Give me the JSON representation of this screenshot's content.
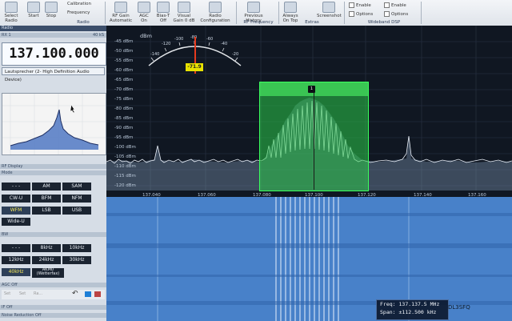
{
  "ribbon": {
    "buttons": [
      "Select Radio",
      "Start",
      "Stop",
      "Calibration",
      "Frequency",
      "RF Gain Automatic",
      "AGC On",
      "Bias-T Off",
      "Visual Gain 0 dB",
      "Radio Configuration",
      "Previous History",
      "Next History",
      "Always On Top",
      "Screenshot"
    ],
    "groups": [
      "Radio",
      "RF Frequency",
      "Extras",
      "Wideband DSP"
    ],
    "checks": [
      "Enable",
      "Options",
      "Enable",
      "Options"
    ]
  },
  "left": {
    "panel_title": "Radio",
    "rx_label": "RX 1",
    "rx_level": "40 kS",
    "frequency": "137.100.000",
    "audio_device": "Lautsprecher (2- High Definition Audio Device)",
    "rf_display_title": "RF Display",
    "mode_title": "Mode",
    "modes": [
      "- - -",
      "AM",
      "SAM",
      "CW-U",
      "BFM",
      "NFM",
      "WFM",
      "LSB",
      "USB",
      "Wide-U"
    ],
    "selected_mode": "WFM",
    "bw_title": "BW",
    "bandwidths": [
      "- - -",
      "8kHz",
      "10kHz",
      "12kHz",
      "24kHz",
      "30kHz",
      "40kHz",
      "AKM0 (Wetterfax)"
    ],
    "selected_bw": "40kHz",
    "agc_title": "AGC Off",
    "ctrl_title": "IF Off",
    "ctrl_title2": "Noise Reduction Off",
    "buttons_small": [
      "Set",
      "Set",
      "Ra..."
    ]
  },
  "spectrum": {
    "unit": "dBm",
    "db_ticks": [
      "-45 dBm",
      "-50 dBm",
      "-55 dBm",
      "-60 dBm",
      "-65 dBm",
      "-70 dBm",
      "-75 dBm",
      "-80 dBm",
      "-85 dBm",
      "-90 dBm",
      "-95 dBm",
      "-100 dBm",
      "-105 dBm",
      "-110 dBm",
      "-115 dBm",
      "-120 dBm"
    ],
    "freq_ticks": [
      "137.040",
      "137.060",
      "137.080",
      "137.100",
      "137.120",
      "137.140",
      "137.160"
    ],
    "meter_ticks": [
      "-140",
      "-120",
      "-100",
      "-80",
      "-60",
      "-40",
      "-20"
    ],
    "meter_value": "-71.9",
    "channel_marker": "1"
  },
  "info": {
    "freq_label": "Freq:",
    "freq_value": "137.137.5 MHz",
    "span_label": "Span:",
    "span_value": "±112.500 kHz"
  },
  "callsign": "DL3SFQ"
}
